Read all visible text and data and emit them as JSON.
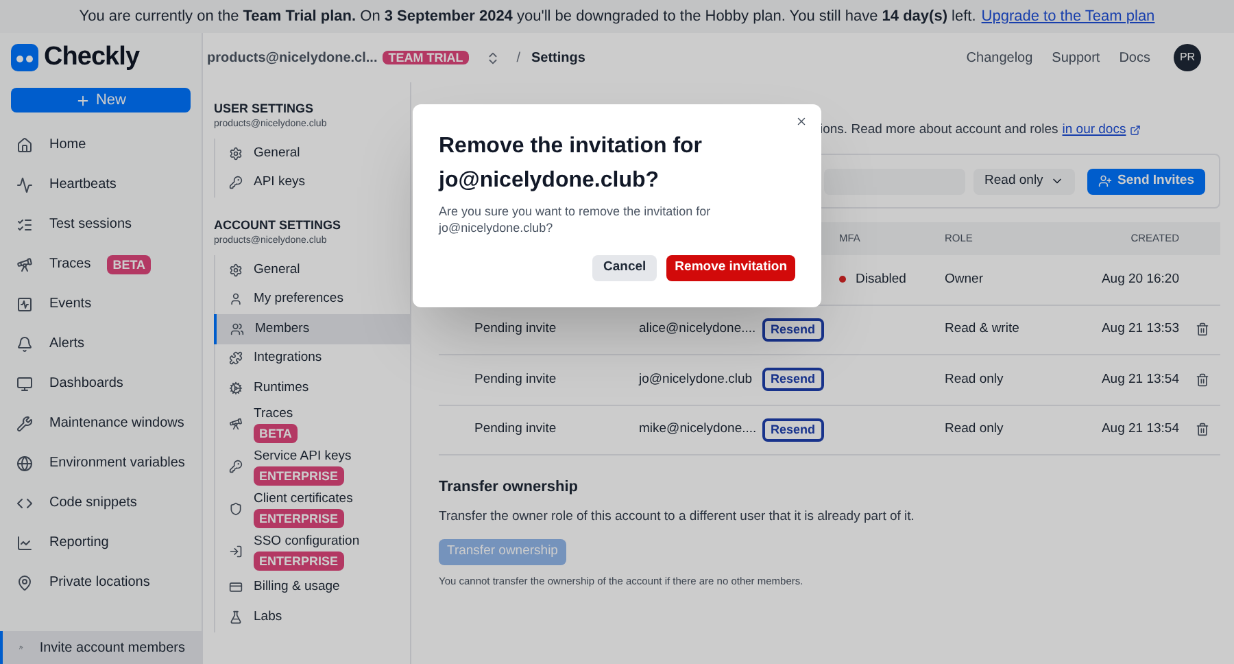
{
  "banner": {
    "text": "You are currently on the **Team Trial plan.** On **3 September 2024** you'll be downgraded to the Hobby plan. You still have **14 day(s)** left.",
    "link": "Upgrade to the Team plan"
  },
  "header": {
    "logo_text": "Checkly",
    "account": "products@nicelydone.cl...",
    "account_badge": "TEAM TRIAL",
    "separator": "/",
    "page": "Settings",
    "links": [
      "Changelog",
      "Support",
      "Docs"
    ],
    "avatar": "PR"
  },
  "sidebar": {
    "new_button": "New",
    "items": [
      {
        "label": "Home",
        "selected": false
      },
      {
        "label": "Heartbeats",
        "selected": false
      },
      {
        "label": "Test sessions",
        "selected": false
      },
      {
        "label": "Traces",
        "badge": "BETA",
        "selected": false
      },
      {
        "label": "Events",
        "selected": false
      },
      {
        "label": "Alerts",
        "selected": false
      },
      {
        "label": "Dashboards",
        "selected": false
      },
      {
        "label": "Maintenance windows",
        "selected": false
      },
      {
        "label": "Environment variables",
        "selected": false
      },
      {
        "label": "Code snippets",
        "selected": false
      },
      {
        "label": "Reporting",
        "selected": false
      },
      {
        "label": "Private locations",
        "selected": false
      }
    ],
    "bottom_item": {
      "label": "Invite account members",
      "selected": true
    }
  },
  "settings_nav": [
    {
      "title": "USER SETTINGS",
      "email": "products@nicelydone.club",
      "items": [
        {
          "label": "General",
          "selected": false
        },
        {
          "label": "API keys",
          "selected": false
        }
      ]
    },
    {
      "title": "ACCOUNT SETTINGS",
      "email": "products@nicelydone.club",
      "items": [
        {
          "label": "General",
          "selected": false
        },
        {
          "label": "My preferences",
          "selected": false
        },
        {
          "label": "Members",
          "selected": true
        },
        {
          "label": "Integrations",
          "selected": false
        },
        {
          "label": "Runtimes",
          "selected": false
        },
        {
          "label": "Traces",
          "badge": "BETA",
          "selected": false
        },
        {
          "label": "Service API keys",
          "badge": "ENTERPRISE",
          "selected": false
        },
        {
          "label": "Client certificates",
          "badge": "ENTERPRISE",
          "selected": false
        },
        {
          "label": "SSO configuration",
          "badge": "ENTERPRISE",
          "selected": false
        },
        {
          "label": "Billing & usage",
          "selected": false
        },
        {
          "label": "Labs",
          "selected": false
        }
      ]
    }
  ],
  "main": {
    "description": "ions. Read more about account and roles",
    "docs_link": "in our docs",
    "invite": {
      "role_select": "Read only",
      "send_button": "Send Invites"
    },
    "table": {
      "columns": [
        "MFA",
        "ROLE",
        "CREATED"
      ],
      "rows": [
        {
          "mfa": "Disabled",
          "role": "Owner",
          "created": "Aug 20 16:20"
        },
        {
          "name": "Pending invite",
          "email": "alice@nicelydone....",
          "resend": "Resend",
          "role": "Read & write",
          "created": "Aug 21 13:53"
        },
        {
          "name": "Pending invite",
          "email": "jo@nicelydone.club",
          "resend": "Resend",
          "role": "Read only",
          "created": "Aug 21 13:54"
        },
        {
          "name": "Pending invite",
          "email": "mike@nicelydone....",
          "resend": "Resend",
          "role": "Read only",
          "created": "Aug 21 13:54"
        }
      ]
    },
    "transfer": {
      "title": "Transfer ownership",
      "text": "Transfer the owner role of this account to a different user that it is already part of it.",
      "button": "Transfer ownership",
      "disabled": true,
      "note": "You cannot transfer the ownership of the account if there are no other members."
    }
  },
  "modal": {
    "title": "Remove the invitation for jo@nicelydone.club?",
    "body": "Are you sure you want to remove the invitation for jo@nicelydone.club?",
    "cancel": "Cancel",
    "confirm": "Remove invitation"
  }
}
